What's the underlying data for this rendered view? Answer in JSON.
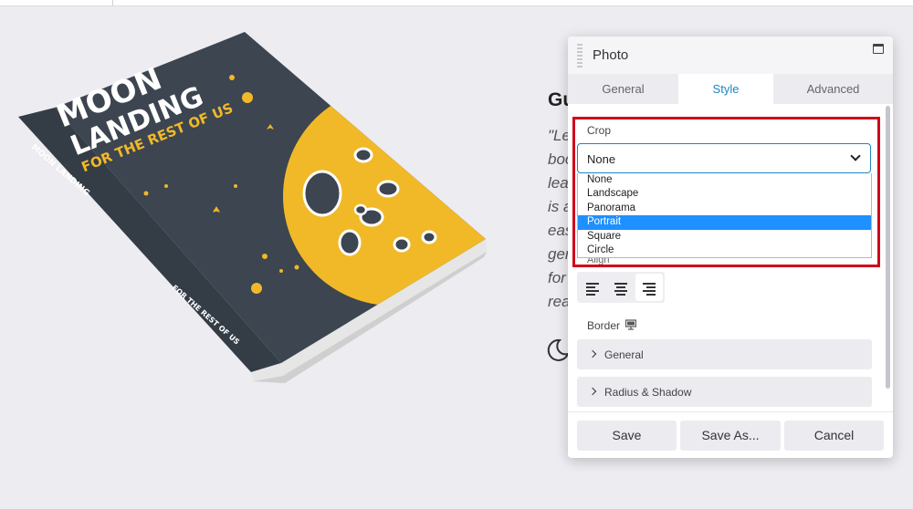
{
  "background": {
    "heading": "Gu",
    "text_lines": [
      "\"Le",
      "boo",
      "lea",
      "is a",
      "eas",
      "gen",
      "for",
      "rea"
    ]
  },
  "book": {
    "title_line1": "MOON",
    "title_line2": "LANDING",
    "subtitle": "FOR THE REST OF US",
    "spine_title": "MOON LANDING",
    "spine_subtitle": "FOR THE REST OF US"
  },
  "panel": {
    "title": "Photo",
    "tabs": [
      {
        "label": "General",
        "active": false
      },
      {
        "label": "Style",
        "active": true
      },
      {
        "label": "Advanced",
        "active": false
      }
    ],
    "crop": {
      "label": "Crop",
      "value": "None",
      "options": [
        "None",
        "Landscape",
        "Panorama",
        "Portrait",
        "Square",
        "Circle"
      ],
      "highlighted_option": "Portrait"
    },
    "align_label": "Align",
    "border_label": "Border",
    "sections": [
      "General",
      "Radius & Shadow"
    ],
    "buttons": {
      "save": "Save",
      "save_as": "Save As...",
      "cancel": "Cancel"
    }
  },
  "colors": {
    "accent": "#1e85c2",
    "highlight_border": "#d0021b",
    "book_cover": "#3c4550",
    "moon": "#f1b928"
  }
}
